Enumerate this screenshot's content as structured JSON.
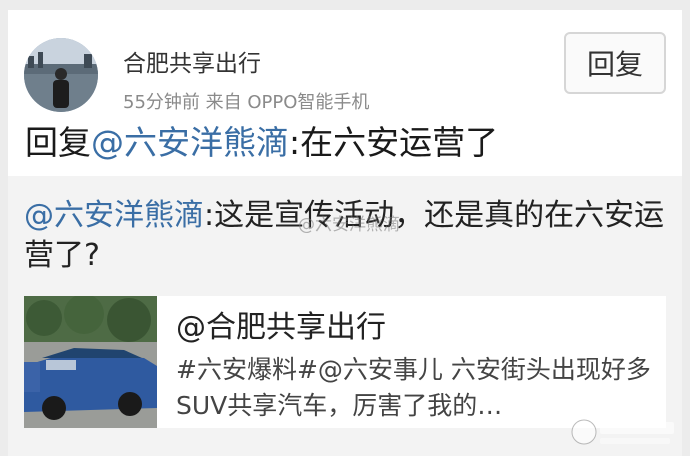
{
  "post": {
    "username": "合肥共享出行",
    "meta": "55分钟前  来自 OPPO智能手机",
    "reply_button": "回复",
    "reply_prefix": "回复",
    "reply_mention": "@六安洋熊滴",
    "reply_body": ":在六安运营了"
  },
  "quote": {
    "mention": "@六安洋熊滴",
    "body": ":这是宣传活动，还是真的在六安运营了?",
    "watermark": "@六安洋熊滴",
    "link_card": {
      "title": "@合肥共享出行",
      "description": "#六安爆料#@六安事儿 六安街头出现好多SUV共享汽车，厉害了我的…"
    }
  }
}
